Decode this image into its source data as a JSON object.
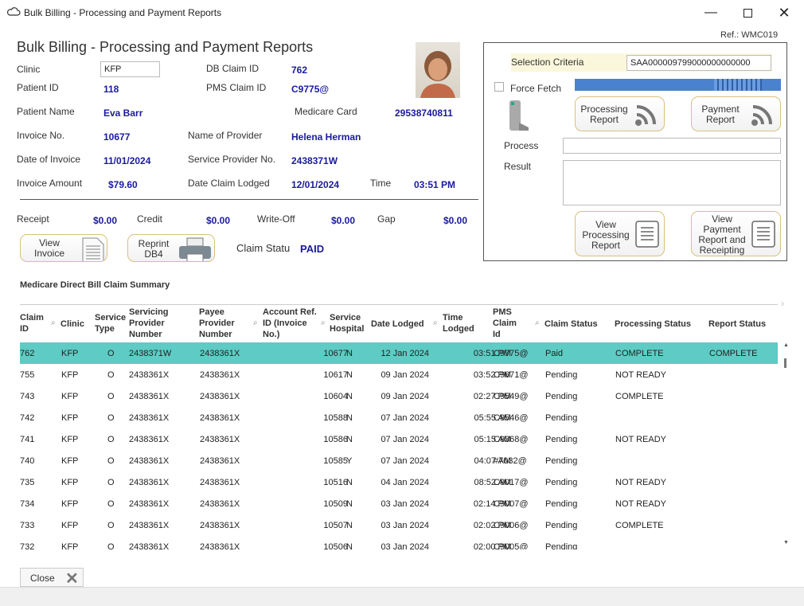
{
  "window": {
    "title": "Bulk Billing - Processing and Payment Reports",
    "ref": "Ref.: WMC019"
  },
  "header": {
    "title": "Bulk Billing - Processing and Payment Reports"
  },
  "fields": {
    "clinic_label": "Clinic",
    "clinic_value": "KFP",
    "db_claim_label": "DB Claim ID",
    "db_claim_value": "762",
    "patient_id_label": "Patient ID",
    "patient_id_value": "118",
    "pms_claim_label": "PMS Claim ID",
    "pms_claim_value": "C9775@",
    "patient_name_label": "Patient Name",
    "patient_name_value": "Eva Barr",
    "medicare_label": "Medicare Card",
    "medicare_value": "29538740811",
    "invoice_no_label": "Invoice No.",
    "invoice_no_value": "10677",
    "provider_label": "Name of Provider",
    "provider_value": "Helena Herman",
    "doi_label": "Date of Invoice",
    "doi_value": "11/01/2024",
    "spn_label": "Service Provider No.",
    "spn_value": "2438371W",
    "amount_label": "Invoice Amount",
    "amount_value": "$79.60",
    "lodged_label": "Date Claim Lodged",
    "lodged_value": "12/01/2024",
    "time_label": "Time",
    "time_value": "03:51 PM",
    "receipt_label": "Receipt",
    "receipt_value": "$0.00",
    "credit_label": "Credit",
    "credit_value": "$0.00",
    "writeoff_label": "Write-Off",
    "writeoff_value": "$0.00",
    "gap_label": "Gap",
    "gap_value": "$0.00",
    "claim_status_label": "Claim Statu",
    "claim_status_value": "PAID"
  },
  "buttons": {
    "view_invoice": "View Invoice",
    "reprint": "Reprint DB4",
    "processing_report": "Processing Report",
    "payment_report": "Payment Report",
    "view_processing": "View Processing Report",
    "view_payment": "View Payment Report and Receipting",
    "close": "Close"
  },
  "criteria": {
    "label": "Selection Criteria",
    "value": "SAA000009799000000000000",
    "force_fetch": "Force Fetch",
    "process_label": "Process",
    "result_label": "Result"
  },
  "summary": {
    "title": "Medicare Direct Bill Claim Summary",
    "columns": [
      "Claim ID",
      "Clinic",
      "Service Type",
      "Servicing Provider Number",
      "Payee Provider Number",
      "Account Ref. ID (Invoice No.)",
      "Service Hospital",
      "Date Lodged",
      "Time Lodged",
      "PMS Claim Id",
      "Claim Status",
      "Processing Status",
      "Report Status"
    ],
    "rows": [
      [
        "762",
        "KFP",
        "O",
        "2438371W",
        "2438361X",
        "10677",
        "N",
        "12 Jan 2024",
        "03:51 PM",
        "C9775@",
        "Paid",
        "COMPLETE",
        "COMPLETE"
      ],
      [
        "755",
        "KFP",
        "O",
        "2438361X",
        "2438361X",
        "10617",
        "N",
        "09 Jan 2024",
        "03:52 PM",
        "C9671@",
        "Pending",
        "NOT READY",
        ""
      ],
      [
        "743",
        "KFP",
        "O",
        "2438361X",
        "2438361X",
        "10604",
        "N",
        "09 Jan 2024",
        "02:27 PM",
        "C9549@",
        "Pending",
        "COMPLETE",
        ""
      ],
      [
        "742",
        "KFP",
        "O",
        "2438361X",
        "2438361X",
        "10588",
        "N",
        "07 Jan 2024",
        "05:55 AM",
        "C9546@",
        "Pending",
        "",
        ""
      ],
      [
        "741",
        "KFP",
        "O",
        "2438361X",
        "2438361X",
        "10586",
        "N",
        "07 Jan 2024",
        "05:15 AM",
        "C9368@",
        "Pending",
        "NOT READY",
        ""
      ],
      [
        "740",
        "KFP",
        "O",
        "2438361X",
        "2438361X",
        "10585",
        "Y",
        "07 Jan 2024",
        "04:07 AM",
        "#7032@",
        "Pending",
        "",
        ""
      ],
      [
        "735",
        "KFP",
        "O",
        "2438361X",
        "2438361X",
        "10516",
        "N",
        "04 Jan 2024",
        "08:52 AM",
        "C9017@",
        "Pending",
        "NOT READY",
        ""
      ],
      [
        "734",
        "KFP",
        "O",
        "2438361X",
        "2438361X",
        "10509",
        "N",
        "03 Jan 2024",
        "02:14 PM",
        "C9007@",
        "Pending",
        "NOT READY",
        ""
      ],
      [
        "733",
        "KFP",
        "O",
        "2438361X",
        "2438361X",
        "10507",
        "N",
        "03 Jan 2024",
        "02:02 PM",
        "C9006@",
        "Pending",
        "COMPLETE",
        ""
      ],
      [
        "732",
        "KFP",
        "O",
        "2438361X",
        "2438361X",
        "10506",
        "N",
        "03 Jan 2024",
        "02:00 PM",
        "C9005@",
        "Pending",
        "",
        ""
      ]
    ]
  }
}
